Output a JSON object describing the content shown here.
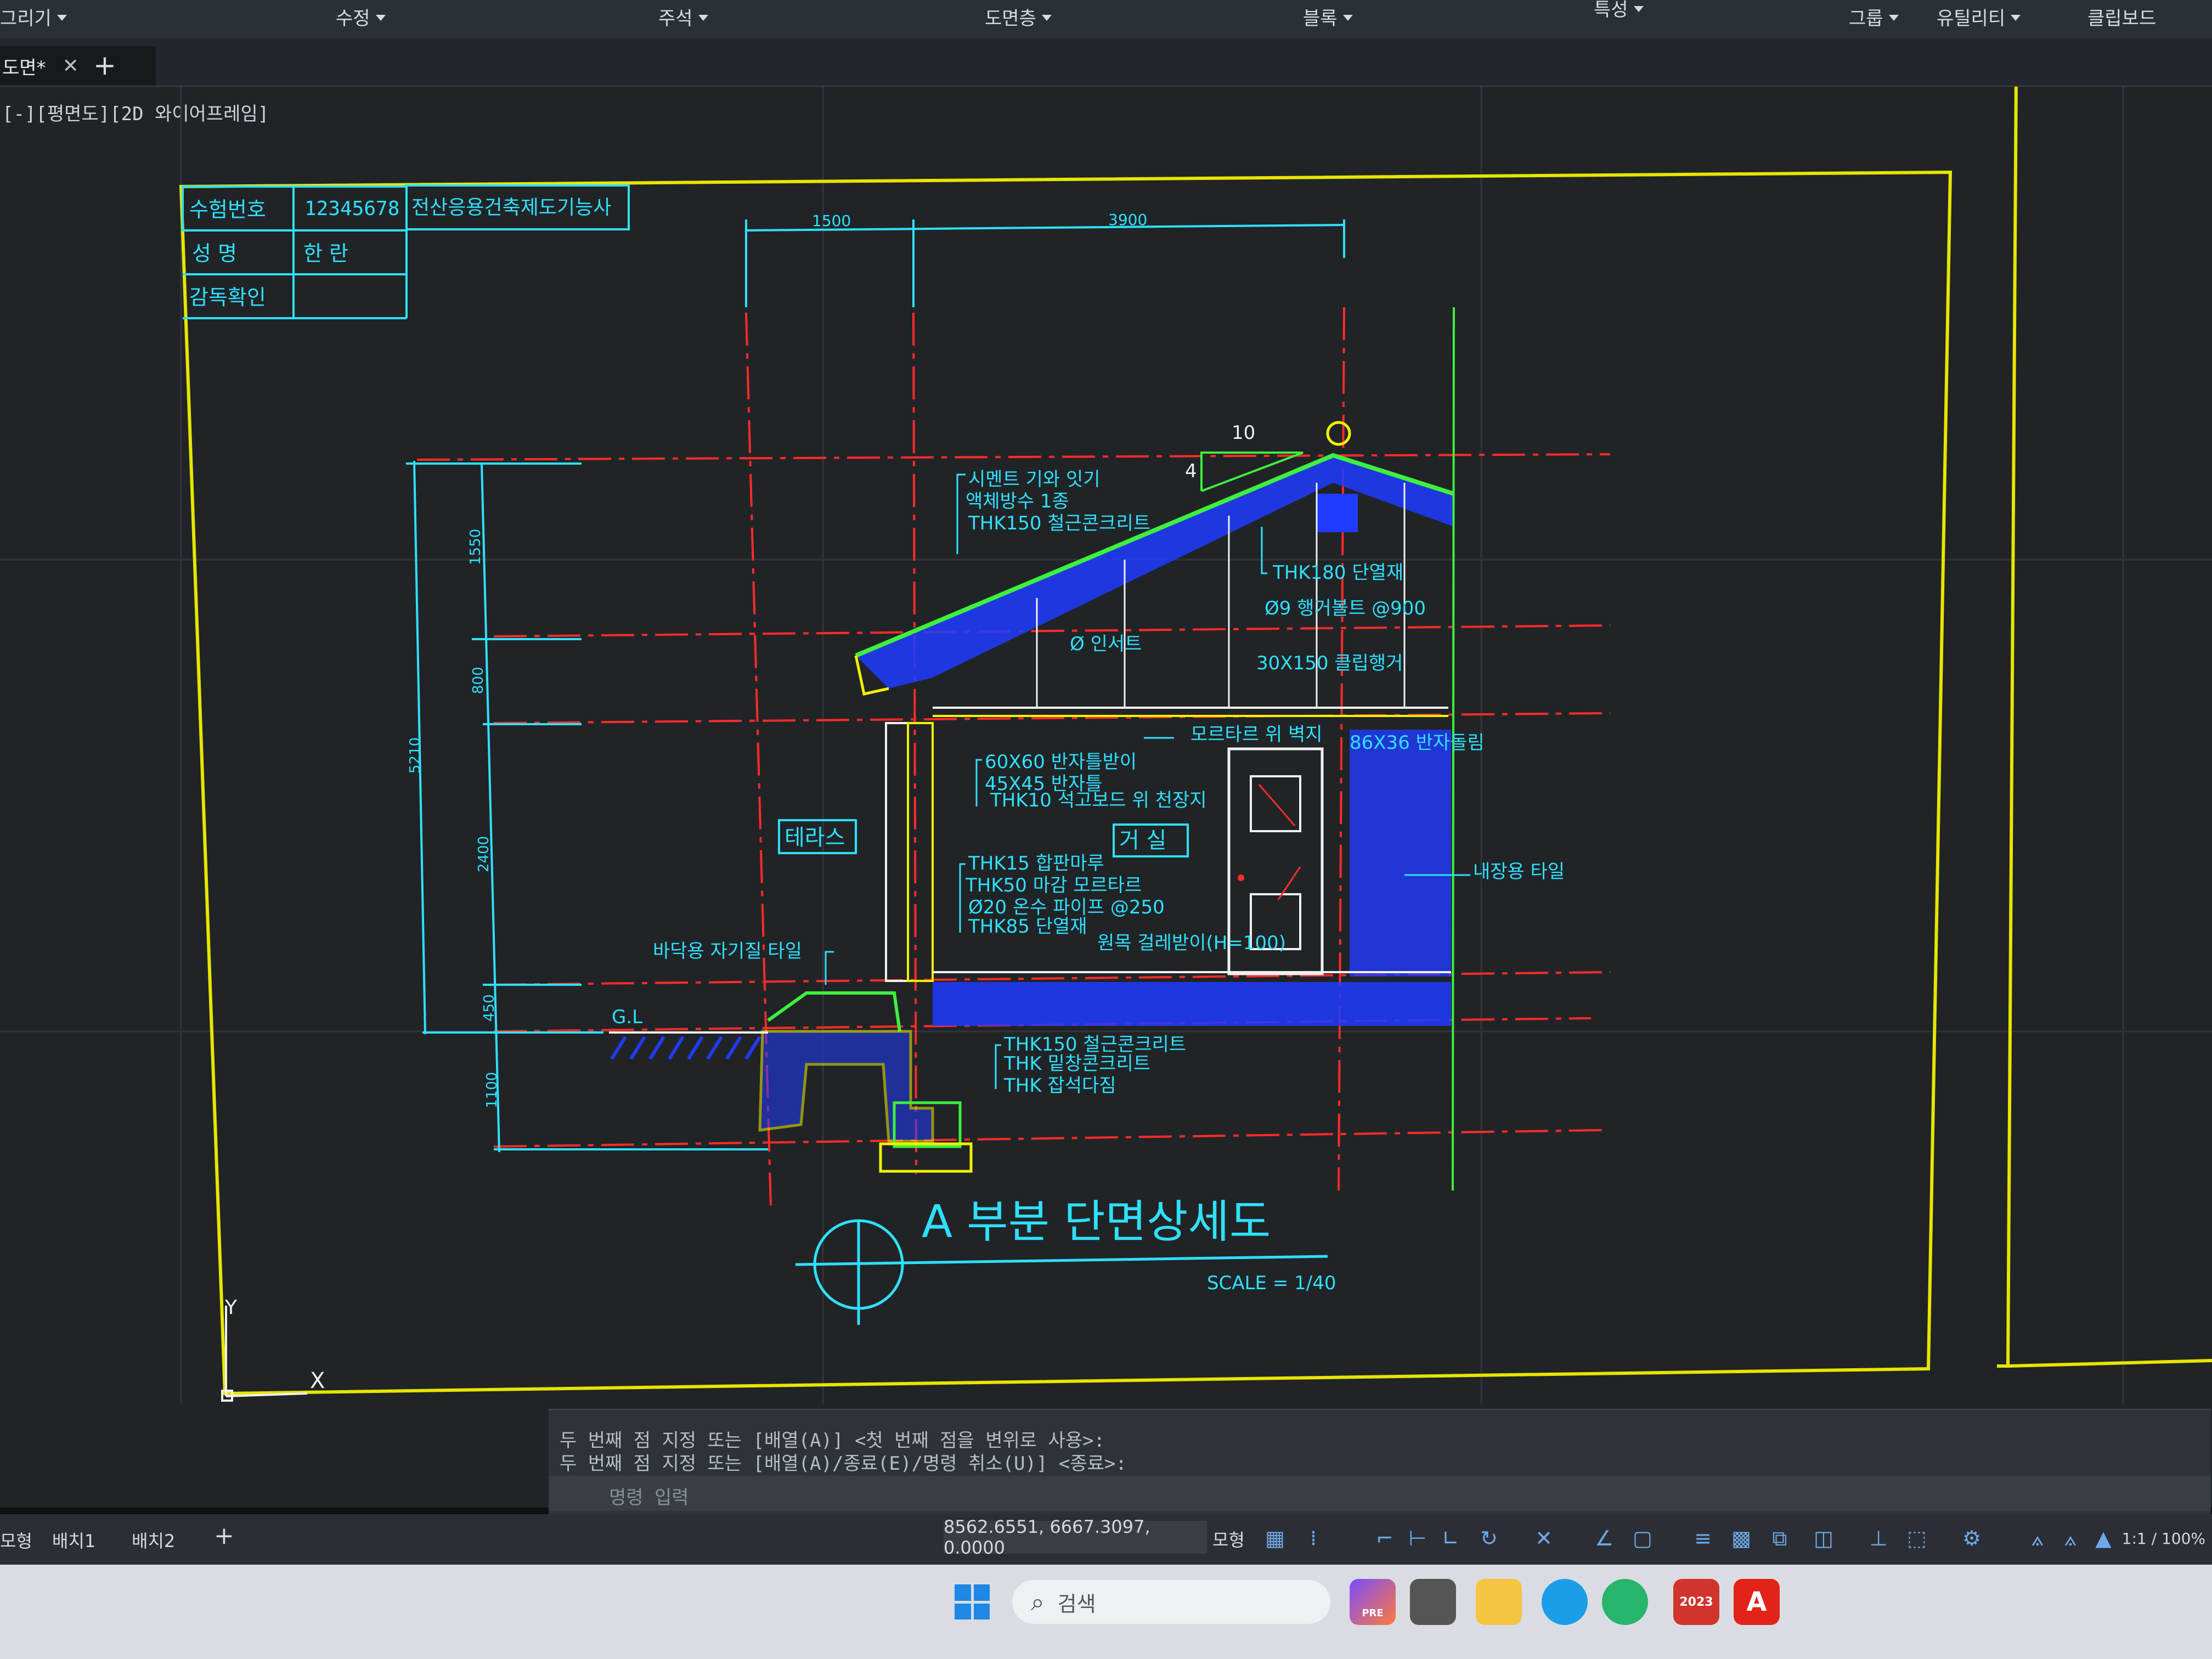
{
  "ribbon": {
    "panels": [
      {
        "label": "그리기"
      },
      {
        "label": "수정"
      },
      {
        "label": "주석"
      },
      {
        "label": "도면층"
      },
      {
        "label": "블록"
      },
      {
        "label": "특성"
      },
      {
        "label": "그룹"
      },
      {
        "label": "유틸리티"
      },
      {
        "label": "클립보드"
      }
    ]
  },
  "document_tab": {
    "label": "도면*"
  },
  "viewport_label": "[-][평면도][2D 와이어프레임]",
  "title_block": {
    "row1": {
      "label": "수험번호",
      "value": "12345678",
      "note": "전산응용건축제도기능사"
    },
    "row2": {
      "label": "성      명",
      "value": "한      란"
    },
    "row3": {
      "label": "감독확인",
      "value": ""
    }
  },
  "drawing": {
    "title": "A 부분 단면상세도",
    "scale": "SCALE = 1/40",
    "dims_top": [
      "1500",
      "3900"
    ],
    "dims_left": [
      "1550",
      "800",
      "2400",
      "450",
      "1100"
    ],
    "dim_total": "5210",
    "slope": {
      "run": "10",
      "rise": "4"
    },
    "rooms": [
      "테라스",
      "거 실"
    ],
    "ground_label": "G.L",
    "notes_roof": [
      "시멘트 기와 잇기",
      "액체방수 1종",
      "THK150 철근콘크리트"
    ],
    "notes_ceiling": [
      "THK180 단열재",
      "Ø9 행거볼트 @900",
      "Ø 인서트",
      "30X150 클립행거"
    ],
    "note_wall": "모르타르 위 벽지",
    "note_molding": "86X36 반자돌림",
    "notes_ceiling_frame": [
      "60X60 반자틀받이",
      "45X45 반자틀",
      "THK10 석고보드 위 천장지"
    ],
    "notes_floor": [
      "THK15 합판마루",
      "THK50 마감 모르타르",
      "Ø20 온수 파이프 @250",
      "THK85 단열재"
    ],
    "note_baseboard": "원목 걸레받이(H=100)",
    "note_tile_wall": "내장용 타일",
    "note_tile_floor": "바닥용 자기질 타일",
    "notes_foundation": [
      "THK150 철근콘크리트",
      "THK 밑창콘크리트",
      "THK 잡석다짐"
    ],
    "ucs": {
      "x": "X",
      "y": "Y"
    }
  },
  "command": {
    "history": [
      "두 번째 점 지정 또는 [배열(A)] <첫 번째 점을 변위로 사용>:",
      "두 번째 점 지정 또는 [배열(A)/종료(E)/명령 취소(U)] <종료>:"
    ],
    "placeholder": "명령 입력"
  },
  "status": {
    "layout_tabs": [
      "모형",
      "배치1",
      "배치2"
    ],
    "coords": "8562.6551, 6667.3097, 0.0000",
    "model_label": "모형",
    "zoom": "1:1 / 100%"
  },
  "taskbar": {
    "search_label": "검색",
    "apps": [
      {
        "name": "copilot",
        "text": "PRE"
      },
      {
        "name": "task-view",
        "text": ""
      },
      {
        "name": "file-explorer",
        "text": ""
      },
      {
        "name": "edge",
        "text": ""
      },
      {
        "name": "app-green",
        "text": ""
      },
      {
        "name": "sketchup",
        "text": "2023"
      },
      {
        "name": "autocad",
        "text": "A"
      }
    ]
  },
  "colors": {
    "canvas": "#212426",
    "cyan": "#2fe0ff",
    "yellow": "#f2f200",
    "red_centerline": "#ff2a2a",
    "blue": "#1f3bff",
    "green": "#3ef03e",
    "white": "#f0f0f0"
  }
}
